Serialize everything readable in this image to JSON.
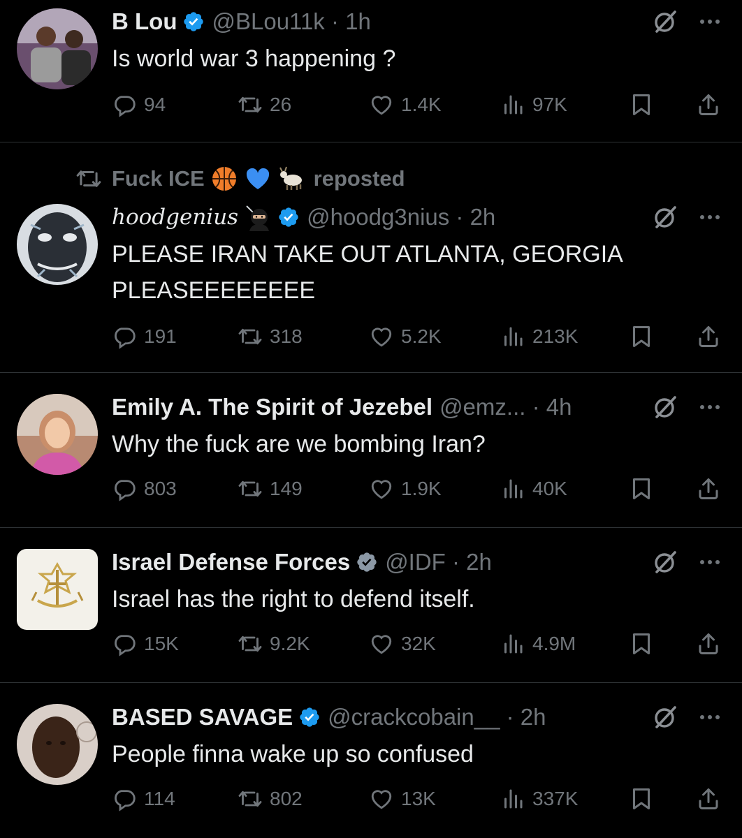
{
  "tweets": [
    {
      "name": "B Lou",
      "handle": "@BLou11k · 1h",
      "text": "Is world war 3 happening ?",
      "replies": "94",
      "reposts": "26",
      "likes": "1.4K",
      "views": "97K"
    },
    {
      "repost_label": "Fuck ICE",
      "repost_suffix": "reposted",
      "name": "hoodgenius",
      "handle": "@hoodg3nius · 2h",
      "text": "PLEASE IRAN TAKE OUT ATLANTA, GEORGIA PLEASEEEEEEEE",
      "replies": "191",
      "reposts": "318",
      "likes": "5.2K",
      "views": "213K"
    },
    {
      "name": "Emily A. The Spirit of Jezebel",
      "handle": "@emz... · 4h",
      "text": "Why the fuck are we bombing Iran?",
      "replies": "803",
      "reposts": "149",
      "likes": "1.9K",
      "views": "40K"
    },
    {
      "name": "Israel Defense Forces",
      "handle": "@IDF · 2h",
      "text": "Israel has the right to defend itself.",
      "replies": "15K",
      "reposts": "9.2K",
      "likes": "32K",
      "views": "4.9M"
    },
    {
      "name": "BASED SAVAGE",
      "handle": "@crackcobain__ · 2h",
      "text": "People finna wake up so confused",
      "replies": "114",
      "reposts": "802",
      "likes": "13K",
      "views": "337K"
    }
  ],
  "icons": {
    "verified": "verified-badge-icon",
    "grok": "grok-icon",
    "more": "more-icon",
    "reply": "reply-icon",
    "repost": "repost-icon",
    "like": "like-icon",
    "views": "views-icon",
    "bookmark": "bookmark-icon",
    "share": "share-icon"
  },
  "colors": {
    "background": "#000000",
    "text": "#e7e9ea",
    "muted": "#71767b",
    "verified": "#1d9bf0",
    "divider": "#2f3336"
  }
}
